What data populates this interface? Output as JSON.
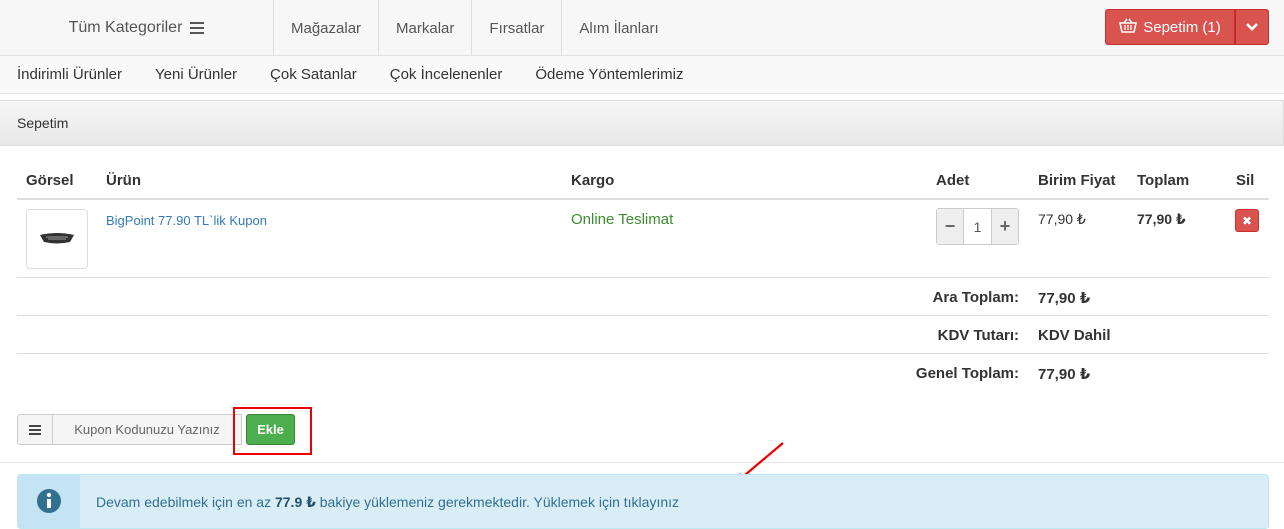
{
  "topnav": {
    "all_categories": "Tüm Kategoriler",
    "links": [
      "Mağazalar",
      "Markalar",
      "Fırsatlar",
      "Alım İlanları"
    ],
    "cart_label": "Sepetim (1)"
  },
  "subnav": {
    "links": [
      "İndirimli Ürünler",
      "Yeni Ürünler",
      "Çok Satanlar",
      "Çok İncelenenler",
      "Ödeme Yöntemlerimiz"
    ]
  },
  "panel": {
    "title": "Sepetim"
  },
  "table": {
    "headers": {
      "image": "Görsel",
      "product": "Ürün",
      "cargo": "Kargo",
      "qty": "Adet",
      "unit_price": "Birim Fiyat",
      "total": "Toplam",
      "delete": "Sil"
    },
    "row": {
      "product": "BigPoint 77.90 TL`lik Kupon",
      "cargo": "Online Teslimat",
      "qty": "1",
      "unit_price": "77,90 ₺",
      "total": "77,90 ₺"
    }
  },
  "summary": {
    "subtotal_label": "Ara Toplam:",
    "subtotal_value": "77,90 ₺",
    "vat_label": "KDV Tutarı:",
    "vat_value": "KDV Dahil",
    "grand_label": "Genel Toplam:",
    "grand_value": "77,90 ₺"
  },
  "coupon": {
    "placeholder": "Kupon Kodunuzu Yazınız",
    "add_label": "Ekle"
  },
  "alert": {
    "text_before": "Devam edebilmek için en az ",
    "amount": "77.9 ₺",
    "text_after": " bakiye yüklemeniz gerekmektedir. Yüklemek için ",
    "link": "tıklayınız"
  },
  "colors": {
    "danger": "#d9534f",
    "success": "#4cae4c",
    "info_bg": "#d9edf7",
    "link": "#337ab7"
  }
}
